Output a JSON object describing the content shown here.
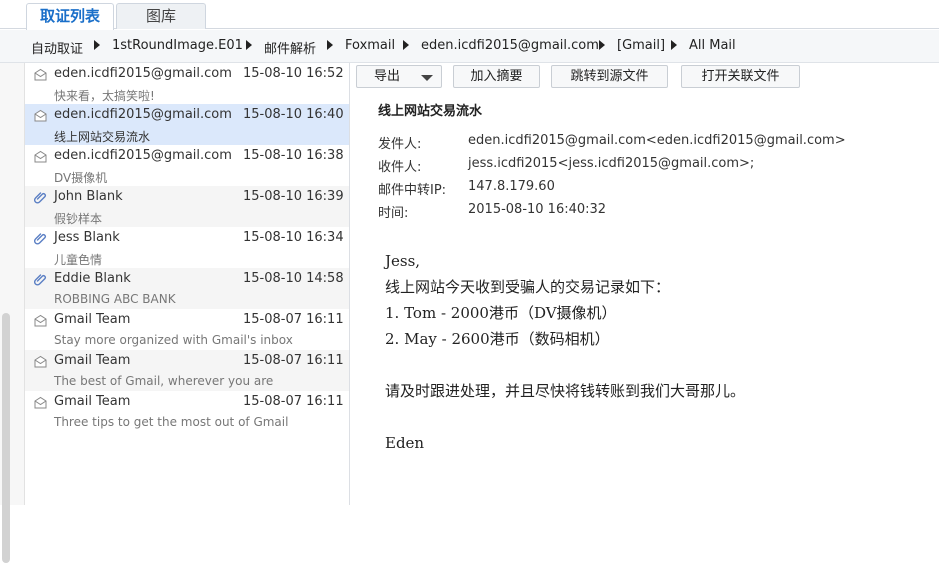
{
  "tabs": [
    {
      "label": "取证列表",
      "active": true
    },
    {
      "label": "图库",
      "active": false
    }
  ],
  "breadcrumb": [
    "自动取证",
    "1stRoundImage.E01",
    "邮件解析",
    "Foxmail",
    "eden.icdfi2015@gmail.com",
    "[Gmail]",
    "All Mail"
  ],
  "mail_list": [
    {
      "sender": "eden.icdfi2015@gmail.com",
      "time": "15-08-10 16:52",
      "subject": "快来看，太搞笑啦!",
      "icon": "envelope-icon",
      "selected": false
    },
    {
      "sender": "eden.icdfi2015@gmail.com",
      "time": "15-08-10 16:40",
      "subject": "线上网站交易流水",
      "icon": "envelope-icon",
      "selected": true
    },
    {
      "sender": "eden.icdfi2015@gmail.com",
      "time": "15-08-10 16:38",
      "subject": "DV摄像机",
      "icon": "envelope-icon",
      "selected": false
    },
    {
      "sender": "John Blank",
      "time": "15-08-10 16:39",
      "subject": "假钞样本",
      "icon": "paperclip-icon",
      "selected": false
    },
    {
      "sender": "Jess Blank",
      "time": "15-08-10 16:34",
      "subject": "儿童色情",
      "icon": "paperclip-icon",
      "selected": false
    },
    {
      "sender": "Eddie Blank",
      "time": "15-08-10 14:58",
      "subject": "ROBBING ABC BANK",
      "icon": "paperclip-icon",
      "selected": false
    },
    {
      "sender": "Gmail Team",
      "time": "15-08-07 16:11",
      "subject": "Stay more organized with Gmail's inbox",
      "icon": "envelope-icon",
      "selected": false
    },
    {
      "sender": "Gmail Team",
      "time": "15-08-07 16:11",
      "subject": "The best of Gmail, wherever you are",
      "icon": "envelope-icon",
      "selected": false
    },
    {
      "sender": "Gmail Team",
      "time": "15-08-07 16:11",
      "subject": "Three tips to get the most out of Gmail",
      "icon": "envelope-icon",
      "selected": false
    }
  ],
  "toolbar": {
    "export": "导出",
    "add_summary": "加入摘要",
    "jump_source": "跳转到源文件",
    "open_related": "打开关联文件"
  },
  "detail": {
    "subject": "线上网站交易流水",
    "headers": [
      {
        "label": "发件人:",
        "value": "eden.icdfi2015@gmail.com<eden.icdfi2015@gmail.com>"
      },
      {
        "label": "收件人:",
        "value": "jess.icdfi2015<jess.icdfi2015@gmail.com>;"
      },
      {
        "label": "邮件中转IP:",
        "value": "147.8.179.60"
      },
      {
        "label": "时间:",
        "value": "2015-08-10 16:40:32"
      }
    ],
    "body_lines": [
      "Jess,",
      "线上网站今天收到受骗人的交易记录如下：",
      "1. Tom - 2000港币（DV摄像机）",
      "2. May - 2600港币（数码相机）",
      "",
      "请及时跟进处理，并且尽快将钱转账到我们大哥那儿。",
      "",
      "Eden"
    ]
  },
  "colors": {
    "accent": "#1a6fc9",
    "selected_row": "#dbe8fb",
    "alt_row": "#f5f5f5"
  }
}
